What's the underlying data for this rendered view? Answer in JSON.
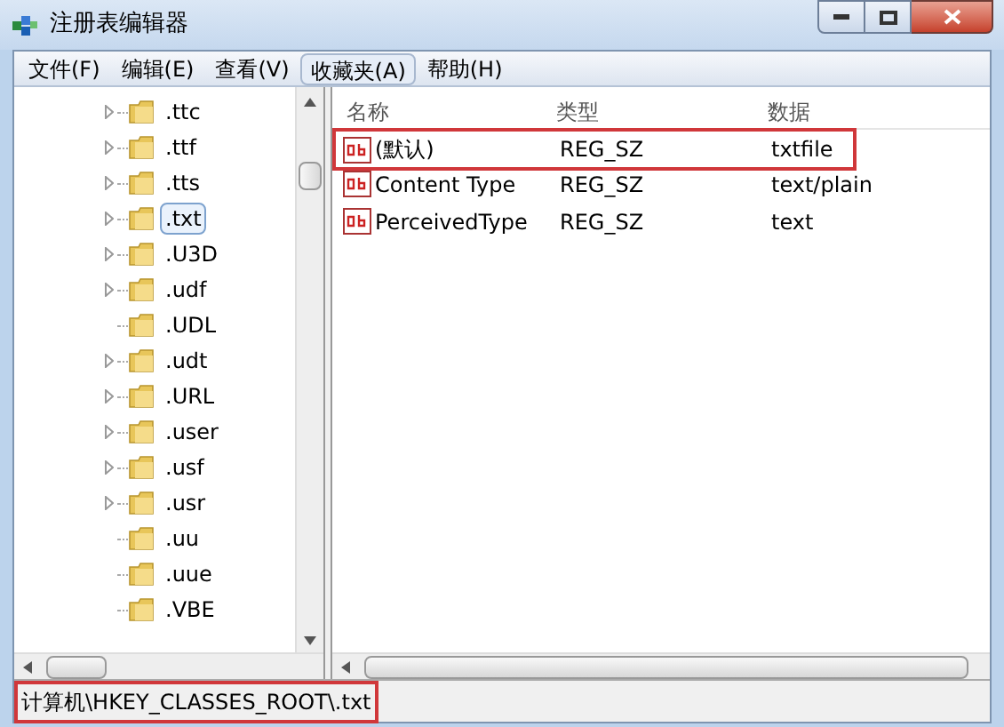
{
  "window": {
    "title": "注册表编辑器"
  },
  "menu": [
    {
      "label": "文件(F)",
      "selected": false
    },
    {
      "label": "编辑(E)",
      "selected": false
    },
    {
      "label": "查看(V)",
      "selected": false
    },
    {
      "label": "收藏夹(A)",
      "selected": true
    },
    {
      "label": "帮助(H)",
      "selected": false
    }
  ],
  "tree": {
    "items": [
      {
        "label": ".ttc",
        "expandable": true,
        "selected": false
      },
      {
        "label": ".ttf",
        "expandable": true,
        "selected": false
      },
      {
        "label": ".tts",
        "expandable": true,
        "selected": false
      },
      {
        "label": ".txt",
        "expandable": true,
        "selected": true
      },
      {
        "label": ".U3D",
        "expandable": true,
        "selected": false
      },
      {
        "label": ".udf",
        "expandable": true,
        "selected": false
      },
      {
        "label": ".UDL",
        "expandable": false,
        "selected": false
      },
      {
        "label": ".udt",
        "expandable": true,
        "selected": false
      },
      {
        "label": ".URL",
        "expandable": true,
        "selected": false
      },
      {
        "label": ".user",
        "expandable": true,
        "selected": false
      },
      {
        "label": ".usf",
        "expandable": true,
        "selected": false
      },
      {
        "label": ".usr",
        "expandable": true,
        "selected": false
      },
      {
        "label": ".uu",
        "expandable": false,
        "selected": false
      },
      {
        "label": ".uue",
        "expandable": false,
        "selected": false
      },
      {
        "label": ".VBE",
        "expandable": false,
        "selected": false
      }
    ]
  },
  "table": {
    "columns": [
      "名称",
      "类型",
      "数据"
    ],
    "rows": [
      {
        "cells": [
          "(默认)",
          "REG_SZ",
          "txtfile"
        ],
        "highlighted": true
      },
      {
        "cells": [
          "Content Type",
          "REG_SZ",
          "text/plain"
        ],
        "highlighted": false
      },
      {
        "cells": [
          "PerceivedType",
          "REG_SZ",
          "text"
        ],
        "highlighted": false
      }
    ]
  },
  "status_bar": {
    "text": "计算机\\HKEY_CLASSES_ROOT\\.txt",
    "highlighted": true
  }
}
